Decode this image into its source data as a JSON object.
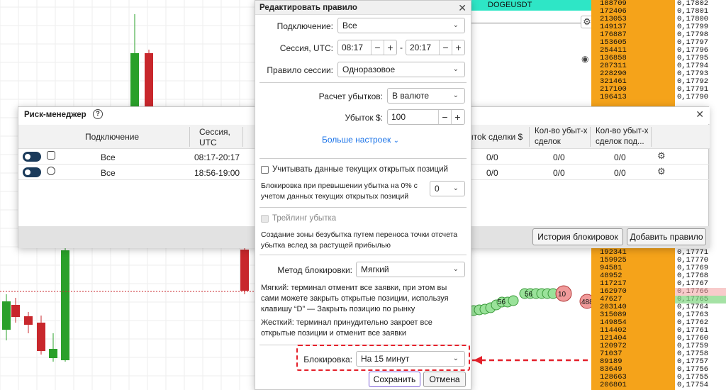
{
  "chart": {
    "ticker": "DOGEUSDT",
    "orderbook_volumes_top": [
      "188709",
      "172406",
      "213053",
      "149137",
      "176887",
      "153605",
      "254411",
      "136858",
      "287311",
      "228290",
      "321461",
      "217100",
      "196413"
    ],
    "orderbook_prices_top": [
      "0,17802",
      "0,17801",
      "0,17800",
      "0,17799",
      "0,17798",
      "0,17797",
      "0,17796",
      "0,17795",
      "0,17794",
      "0,17793",
      "0,17792",
      "0,17791",
      "0,17790"
    ],
    "orderbook_volumes_bottom": [
      "192341",
      "159925",
      "94581",
      "48952",
      "117217",
      "162970",
      "47627",
      "203140",
      "315089",
      "149854",
      "114402",
      "121404",
      "120972",
      "71037",
      "89189",
      "83649",
      "128663",
      "206801"
    ],
    "orderbook_prices_bottom": [
      "0,17771",
      "0,17770",
      "0,17769",
      "0,17768",
      "0,17767",
      "0,17766",
      "0,17765",
      "0,17764",
      "0,17763",
      "0,17762",
      "0,17761",
      "0,17760",
      "0,17759",
      "0,17758",
      "0,17757",
      "0,17756",
      "0,17755",
      "0,17754"
    ],
    "trade_labels": [
      "56",
      "56",
      "10",
      "488"
    ],
    "colors": {
      "orderbook": "#f5a31a",
      "ticker_bg": "#2ee6c6",
      "bull": "#2aa02a",
      "bear": "#c8272c",
      "highlight": "#e4202a"
    }
  },
  "risk_manager": {
    "title": "Риск-менеджер",
    "help_icon": "question-circle-icon",
    "columns": [
      "Подключение",
      "Сессия, UTC"
    ],
    "right_columns": [
      "ытоk сделки $",
      "Кол-во убыт-х сделок",
      "Кол-во убыт-х сделок под..."
    ],
    "rows": [
      {
        "connection": "Все",
        "session": "08:17-20:17",
        "c1": "0/0",
        "c2": "0/0",
        "c3": "0/0"
      },
      {
        "connection": "Все",
        "session": "18:56-19:00",
        "c1": "0/0",
        "c2": "0/0",
        "c3": "0/0"
      }
    ],
    "history_button": "История блокировок",
    "add_rule_button": "Добавить правило"
  },
  "edit_rule": {
    "title": "Редактировать правило",
    "connection_label": "Подключение:",
    "connection_value": "Все",
    "session_label": "Сессия, UTC:",
    "session_start": "08:17",
    "session_sep": "-",
    "session_end": "20:17",
    "session_rule_label": "Правило сессии:",
    "session_rule_value": "Одноразовое",
    "loss_calc_label": "Расчет убытков:",
    "loss_calc_value": "В валюте",
    "loss_label": "Убыток $:",
    "loss_value": "100",
    "more_settings": "Больше настроек",
    "consider_positions": "Учитывать данные текущих открытых позиций",
    "block_over_text": "Блокировка при превышении убытка на 0% с учетом данных текущих открытых позиций",
    "block_over_value": "0",
    "trailing_label": "Трейлинг убытка",
    "trailing_desc": "Создание зоны безубытка путем переноса точки отсчета убытка вслед за растущей прибылью",
    "method_label": "Метод блокировки:",
    "method_value": "Мягкий",
    "soft_desc": "Мягкий: терминал отменит все заявки, при этом вы сами можете закрыть открытые позиции, используя клавишу “D” — Закрыть позицию по рынку",
    "hard_desc": "Жесткий: терминал принудительно закроет все открытые позиции и отменит все заявки",
    "block_label": "Блокировка:",
    "block_value": "На 15 минут",
    "save_button": "Сохранить",
    "cancel_button": "Отмена"
  }
}
